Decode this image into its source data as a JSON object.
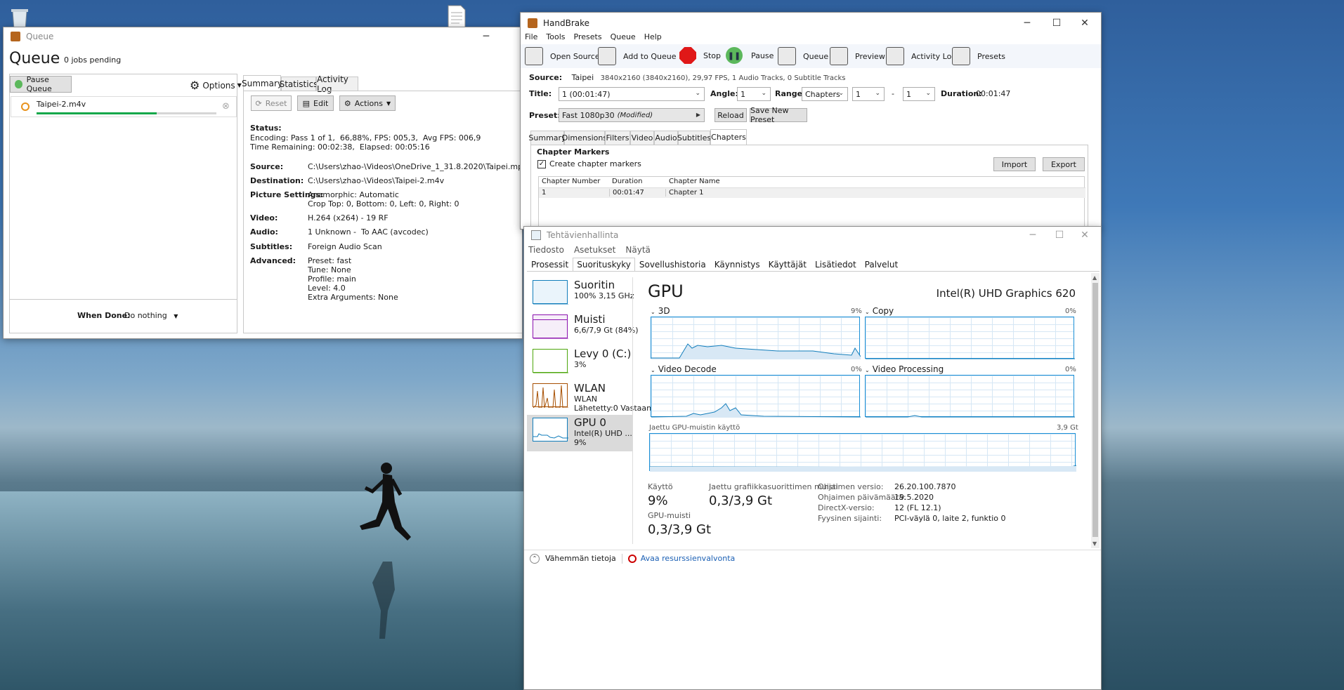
{
  "desktop": {
    "icons": [
      "recycle-bin-icon",
      "document-icon"
    ]
  },
  "queue": {
    "window_title": "Queue",
    "heading": "Queue",
    "jobs_pending": "0 jobs pending",
    "pause_queue": "Pause Queue",
    "options": "Options",
    "job_name": "Taipei-2.m4v",
    "job_progress": 0.6688,
    "tabs": [
      "Summary",
      "Statistics",
      "Activity Log"
    ],
    "reset": "Reset",
    "edit": "Edit",
    "actions": "Actions",
    "status_label": "Status:",
    "status_line1": "Encoding: Pass 1 of 1,  66,88%, FPS: 005,3,  Avg FPS: 006,9",
    "status_line2": "Time Remaining: 00:02:38,  Elapsed: 00:05:16",
    "details": [
      {
        "k": "Source:",
        "v": "C:\\Users\\zhao-\\Videos\\OneDrive_1_31.8.2020\\Taipei.mp4"
      },
      {
        "k": "Destination:",
        "v": "C:\\Users\\zhao-\\Videos\\Taipei-2.m4v"
      },
      {
        "k": "Picture Settings:",
        "v": "Anamorphic: Automatic\nCrop Top: 0, Bottom: 0, Left: 0, Right: 0"
      },
      {
        "k": "Video:",
        "v": "H.264 (x264) - 19 RF"
      },
      {
        "k": "Audio:",
        "v": "1 Unknown -  To AAC (avcodec)"
      },
      {
        "k": "Subtitles:",
        "v": "Foreign Audio Scan"
      },
      {
        "k": "Advanced:",
        "v": "Preset: fast\nTune: None\nProfile: main\nLevel: 4.0\nExtra Arguments: None"
      }
    ],
    "when_done_label": "When Done:",
    "when_done_value": "Do nothing"
  },
  "handbrake": {
    "window_title": "HandBrake",
    "menu": [
      "File",
      "Tools",
      "Presets",
      "Queue",
      "Help"
    ],
    "toolbar": {
      "open_source": "Open Source",
      "add_to_queue": "Add to Queue",
      "stop": "Stop",
      "pause": "Pause",
      "queue": "Queue",
      "preview": "Preview",
      "activity_log": "Activity Log",
      "presets": "Presets"
    },
    "source_label": "Source:",
    "source_name": "Taipei",
    "source_info": "3840x2160 (3840x2160), 29,97 FPS, 1 Audio Tracks, 0 Subtitle Tracks",
    "title_label": "Title:",
    "title_value": "1 (00:01:47)",
    "angle_label": "Angle:",
    "angle_value": "1",
    "range_label": "Range:",
    "range_value": "Chapters",
    "range_from": "1",
    "range_dash": "-",
    "range_to": "1",
    "duration_label": "Duration:",
    "duration_value": "00:01:47",
    "preset_label": "Preset:",
    "preset_value": "Fast 1080p30",
    "preset_modified": "(Modified)",
    "reload": "Reload",
    "save_new_preset": "Save New Preset",
    "tabs": [
      "Summary",
      "Dimensions",
      "Filters",
      "Video",
      "Audio",
      "Subtitles",
      "Chapters"
    ],
    "chapter_markers": "Chapter Markers",
    "create_markers": "Create chapter markers",
    "import": "Import",
    "export": "Export",
    "table_headers": [
      "Chapter Number",
      "Duration",
      "Chapter Name"
    ],
    "table_row": [
      "1",
      "00:01:47",
      "Chapter 1"
    ]
  },
  "taskmgr": {
    "window_title": "Tehtävienhallinta",
    "menu": [
      "Tiedosto",
      "Asetukset",
      "Näytä"
    ],
    "tabs": [
      "Prosessit",
      "Suorituskyky",
      "Sovellushistoria",
      "Käynnistys",
      "Käyttäjät",
      "Lisätiedot",
      "Palvelut"
    ],
    "side": [
      {
        "title": "Suoritin",
        "l1": "100% 3,15 GHz",
        "l2": "",
        "color": "#117dbb"
      },
      {
        "title": "Muisti",
        "l1": "6,6/7,9 Gt (84%)",
        "l2": "",
        "color": "#8b12ae"
      },
      {
        "title": "Levy 0 (C:)",
        "l1": "3%",
        "l2": "",
        "color": "#4da60c"
      },
      {
        "title": "WLAN",
        "l1": "WLAN",
        "l2": "Lähetetty:0 Vastaan",
        "color": "#a74f01"
      },
      {
        "title": "GPU 0",
        "l1": "Intel(R) UHD ...",
        "l2": "9%",
        "color": "#117dbb"
      }
    ],
    "gpu_title": "GPU",
    "gpu_name": "Intel(R) UHD Graphics 620",
    "graphs": [
      {
        "name": "3D",
        "pct": "9%"
      },
      {
        "name": "Copy",
        "pct": "0%"
      },
      {
        "name": "Video Decode",
        "pct": "0%"
      },
      {
        "name": "Video Processing",
        "pct": "0%"
      }
    ],
    "shared_mem_label": "Jaettu GPU-muistin käyttö",
    "shared_mem_max": "3,9 Gt",
    "usage_label": "Käyttö",
    "usage_value": "9%",
    "shared_label": "Jaettu grafiikkasuorittimen muisti",
    "shared_value": "0,3/3,9 Gt",
    "gpu_mem_label": "GPU-muisti",
    "gpu_mem_value": "0,3/3,9 Gt",
    "info": [
      {
        "k": "Ohjaimen versio:",
        "v": "26.20.100.7870"
      },
      {
        "k": "Ohjaimen päivämäärä:",
        "v": "19.5.2020"
      },
      {
        "k": "DirectX-versio:",
        "v": "12 (FL 12.1)"
      },
      {
        "k": "Fyysinen sijainti:",
        "v": "PCI-väylä 0, laite 2, funktio 0"
      }
    ],
    "fewer_details": "Vähemmän tietoja",
    "open_resmon": "Avaa resurssienvalvonta"
  }
}
